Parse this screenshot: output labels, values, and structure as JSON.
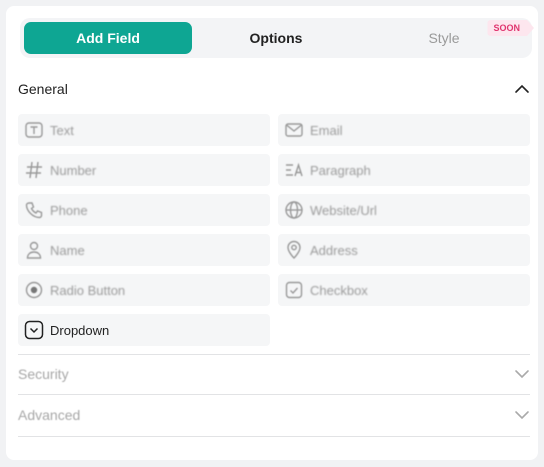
{
  "tabs": [
    {
      "label": "Add Field",
      "active": true
    },
    {
      "label": "Options",
      "active": false
    },
    {
      "label": "Style",
      "active": false,
      "badge": "SOON"
    }
  ],
  "sections": {
    "general": {
      "title": "General",
      "expanded": true
    },
    "security": {
      "title": "Security",
      "expanded": false
    },
    "advanced": {
      "title": "Advanced",
      "expanded": false
    }
  },
  "fields": [
    {
      "label": "Text",
      "icon": "text-icon"
    },
    {
      "label": "Email",
      "icon": "envelope-icon"
    },
    {
      "label": "Number",
      "icon": "hash-icon"
    },
    {
      "label": "Paragraph",
      "icon": "paragraph-icon"
    },
    {
      "label": "Phone",
      "icon": "phone-icon"
    },
    {
      "label": "Website/Url",
      "icon": "globe-icon"
    },
    {
      "label": "Name",
      "icon": "user-icon"
    },
    {
      "label": "Address",
      "icon": "map-pin-icon"
    },
    {
      "label": "Radio Button",
      "icon": "radio-icon"
    },
    {
      "label": "Checkbox",
      "icon": "checkbox-icon"
    },
    {
      "label": "Dropdown",
      "icon": "dropdown-icon"
    }
  ],
  "colors": {
    "accent": "#0ea693",
    "badge_text": "#e0356f",
    "badge_bg": "#fde6ee"
  }
}
